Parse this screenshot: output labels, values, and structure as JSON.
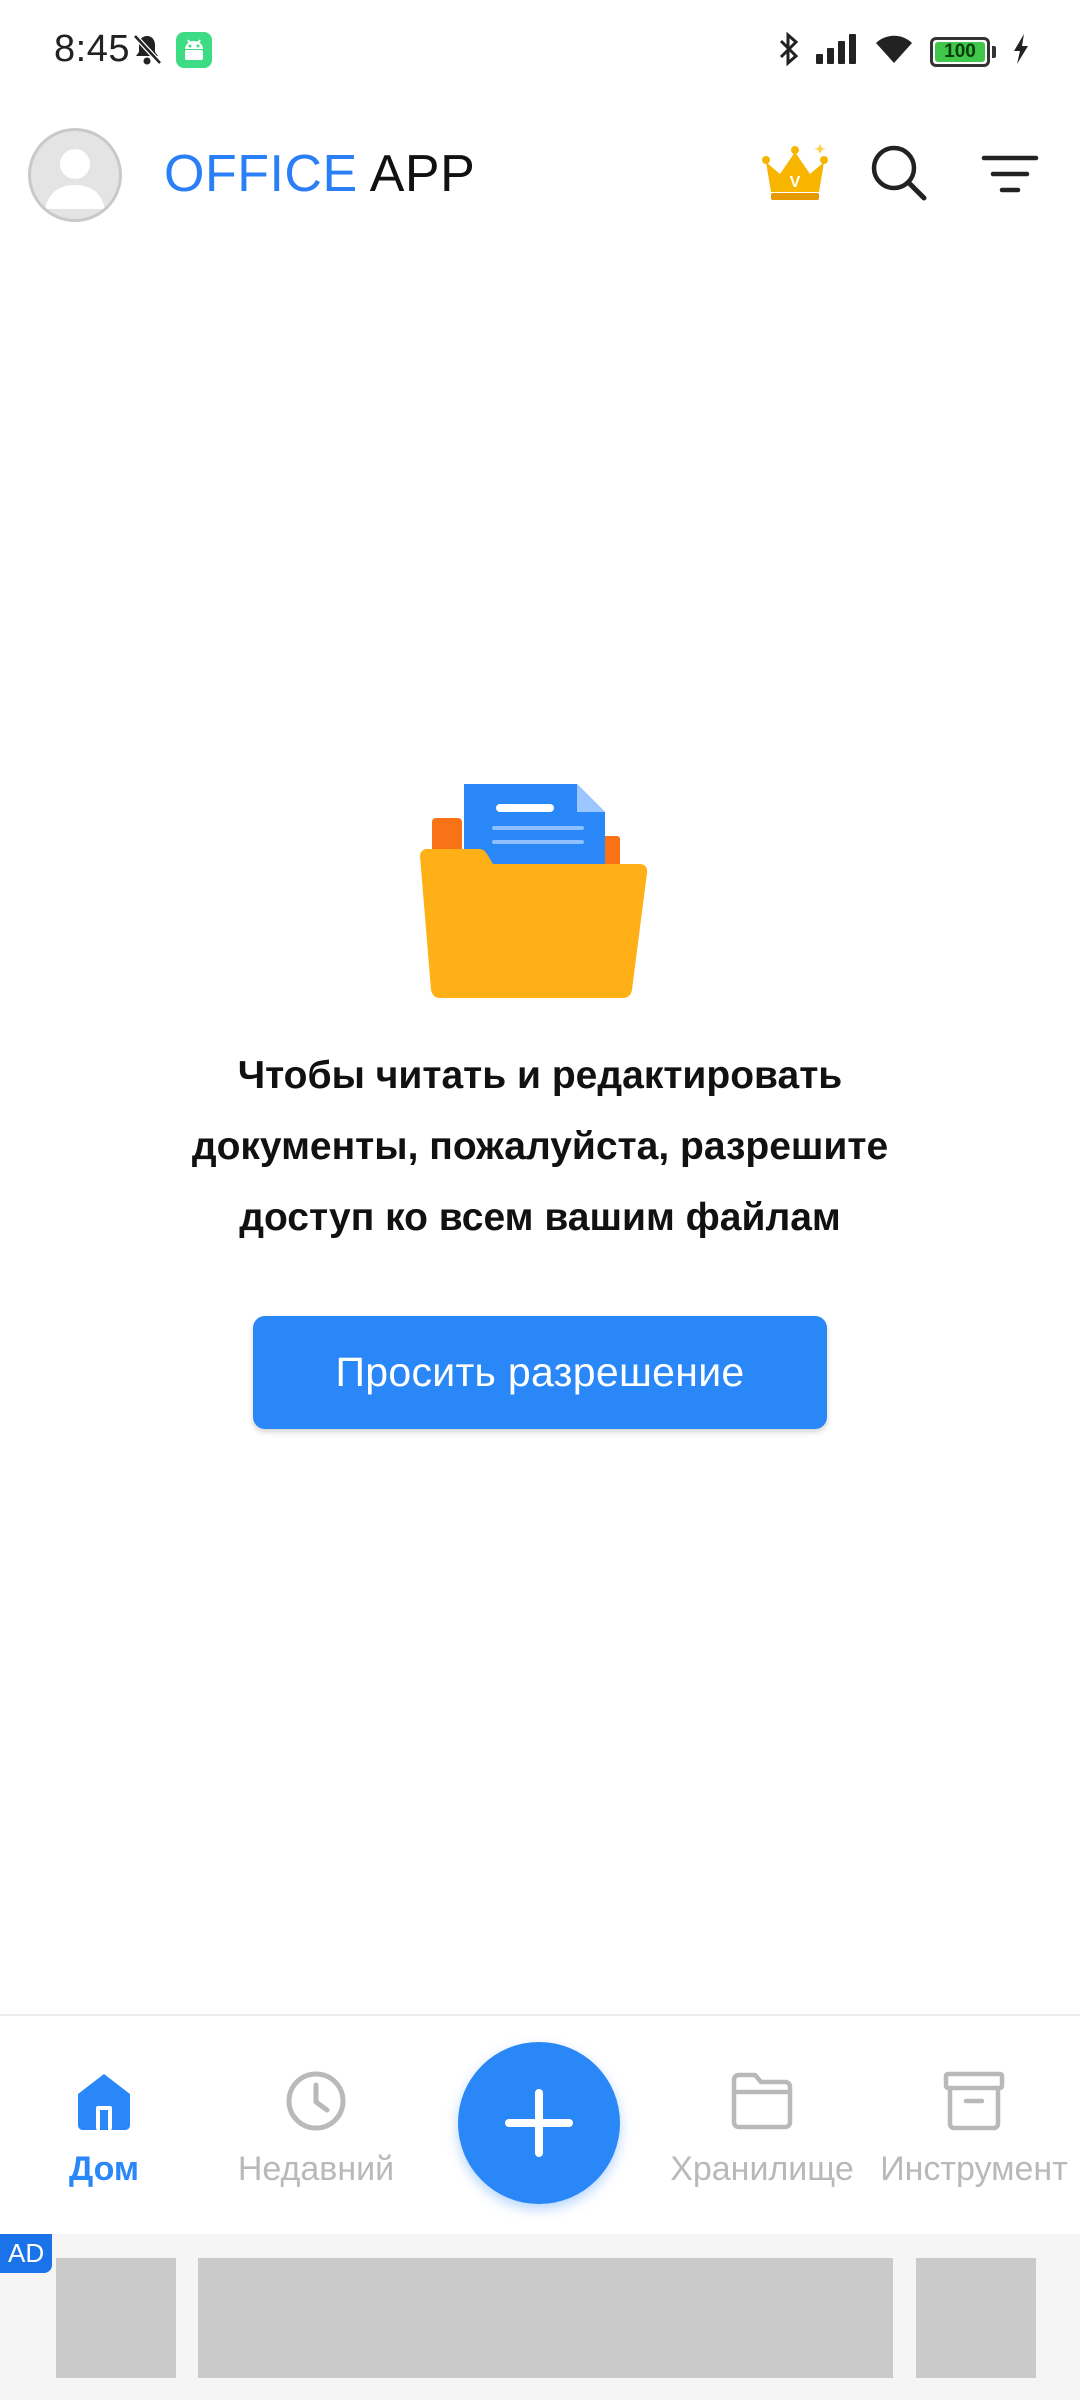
{
  "status_bar": {
    "time": "8:45",
    "battery": "100",
    "battery_level_pct": 100,
    "icons": [
      "bell-muted-icon",
      "android-icon",
      "bluetooth-icon",
      "signal-icon",
      "wifi-icon",
      "battery-icon",
      "charging-icon"
    ]
  },
  "app_bar": {
    "title_part1": "OFFICE",
    "title_part2": "APP",
    "actions": [
      "premium-crown-icon",
      "search-icon",
      "filter-icon"
    ]
  },
  "empty_state": {
    "line1": "Чтобы читать и редактировать",
    "line2": "документы, пожалуйста, разрешите",
    "line3": "доступ ко всем вашим файлам",
    "button_label": "Просить разрешение"
  },
  "bottom_nav": {
    "items": [
      {
        "label": "Дом",
        "icon": "home-icon",
        "active": true
      },
      {
        "label": "Недавний",
        "icon": "clock-icon",
        "active": false
      },
      {
        "label": "Хранилище",
        "icon": "folder-icon",
        "active": false
      },
      {
        "label": "Инструмент",
        "icon": "archive-box-icon",
        "active": false
      }
    ],
    "fab_icon": "plus-icon"
  },
  "ad": {
    "badge": "AD"
  },
  "colors": {
    "accent": "#2a87f7",
    "title_blue": "#2a7ff6",
    "inactive": "#b9b9b9",
    "folder": "#ffb017",
    "doc": "#2a87f7",
    "doc_back": "#f97316"
  }
}
